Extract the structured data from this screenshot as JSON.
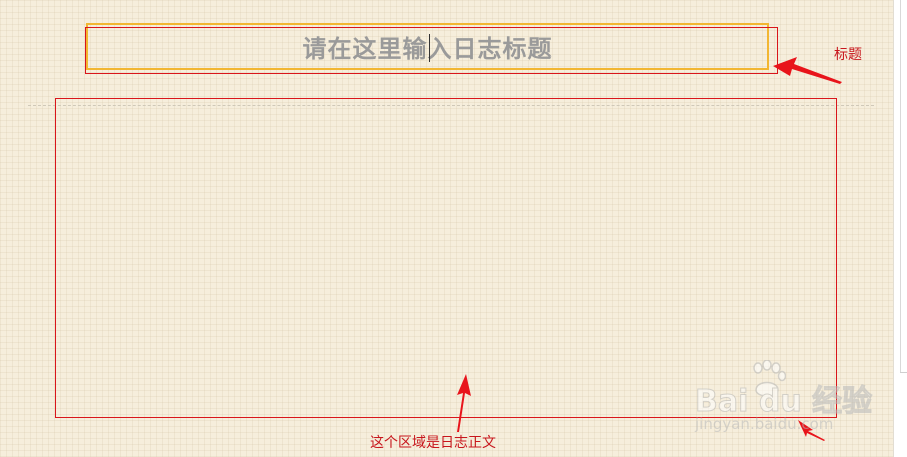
{
  "editor": {
    "title_placeholder": "请在这里输入日志标题"
  },
  "annotations": {
    "title_label": "标题",
    "body_label": "这个区域是日志正文",
    "color": "#c8161d"
  },
  "watermark": {
    "logo_text": "Bai du 经验",
    "site": "jingyan.baidu.com"
  },
  "colors": {
    "background": "#f6eedc",
    "title_border": "#f2b632",
    "highlight": "#d9151b",
    "placeholder_text": "#9a9a9a"
  }
}
